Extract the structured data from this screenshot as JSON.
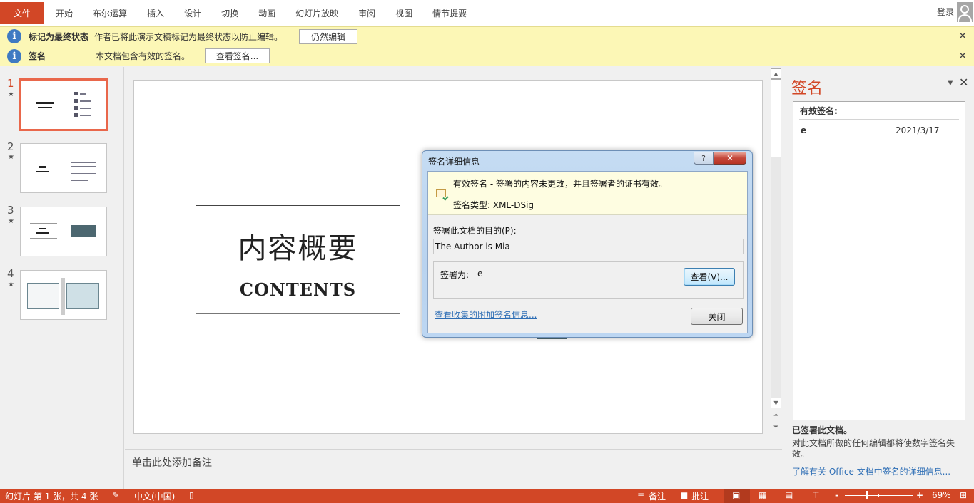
{
  "ribbon": {
    "tabs": [
      "文件",
      "开始",
      "布尔运算",
      "插入",
      "设计",
      "切换",
      "动画",
      "幻灯片放映",
      "审阅",
      "视图",
      "情节提要"
    ],
    "signin_label": "登录"
  },
  "message_bars": [
    {
      "title": "标记为最终状态",
      "text": "作者已将此演示文稿标记为最终状态以防止编辑。",
      "button": "仍然编辑",
      "close": "✕"
    },
    {
      "title": "签名",
      "text": "本文档包含有效的签名。",
      "button": "查看签名...",
      "close": "✕"
    }
  ],
  "thumbnails": [
    {
      "number": "1",
      "star": "★",
      "active": true
    },
    {
      "number": "2",
      "star": "★",
      "active": false
    },
    {
      "number": "3",
      "star": "★",
      "active": false
    },
    {
      "number": "4",
      "star": "★",
      "active": false
    }
  ],
  "slide": {
    "title": "内容概要",
    "subtitle": "CONTENTS"
  },
  "notes": {
    "placeholder": "单击此处添加备注"
  },
  "scrollbar": {
    "up": "▲",
    "down": "▼",
    "prev": "⏶",
    "next": "⏷"
  },
  "signature_pane": {
    "title": "签名",
    "menu_icon": "▼",
    "close_icon": "✕",
    "list_header": "有效签名:",
    "signatures": [
      {
        "name": "e",
        "date": "2021/3/17"
      }
    ],
    "signed_label": "已签署此文档。",
    "warning": "对此文档所做的任何编辑都将使数字签名失效。",
    "link": "了解有关 Office 文档中签名的详细信息..."
  },
  "dialog": {
    "title": "签名详细信息",
    "help": "?",
    "close_x": "✕",
    "status_line": "有效签名 - 签署的内容未更改，并且签署者的证书有效。",
    "type_line": "签名类型: XML-DSig",
    "purpose_label": "签署此文档的目的(P):",
    "purpose_value": "The Author is Mia",
    "signer_label": "签署为:",
    "signer_value": "e",
    "view_button": "查看(V)...",
    "additional_link": "查看收集的附加签名信息...",
    "close_button": "关闭"
  },
  "status_bar": {
    "slide_info": "幻灯片 第 1 张，共 4 张",
    "language": "中文(中国)",
    "notes_label": "备注",
    "comments_label": "批注",
    "zoom_minus": "-",
    "zoom_plus": "+",
    "zoom_level": "69%",
    "zoom_fraction": 0.69
  },
  "colors": {
    "accent": "#d24726",
    "message_bar": "#fcf7b6",
    "link": "#2e6eb5"
  }
}
